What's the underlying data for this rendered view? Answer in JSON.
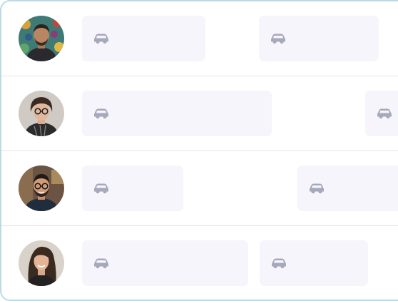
{
  "schedule": {
    "colors": {
      "border": "#b9dbe6",
      "divider": "#dfe3e8",
      "block": "#f5f5fb",
      "car_icon": "#a6a8bb"
    },
    "rows": [
      {
        "avatar": "avatar-man-beard-mural",
        "blocks": [
          {
            "icon": "car-icon"
          },
          {
            "icon": "car-icon"
          }
        ]
      },
      {
        "avatar": "avatar-woman-glasses-curly",
        "blocks": [
          {
            "icon": "car-icon"
          },
          {
            "icon": "car-icon"
          }
        ]
      },
      {
        "avatar": "avatar-man-glasses-beard",
        "blocks": [
          {
            "icon": "car-icon"
          },
          {
            "icon": "car-icon"
          }
        ]
      },
      {
        "avatar": "avatar-woman-long-hair",
        "blocks": [
          {
            "icon": "car-icon"
          },
          {
            "icon": "car-icon"
          }
        ]
      }
    ]
  }
}
